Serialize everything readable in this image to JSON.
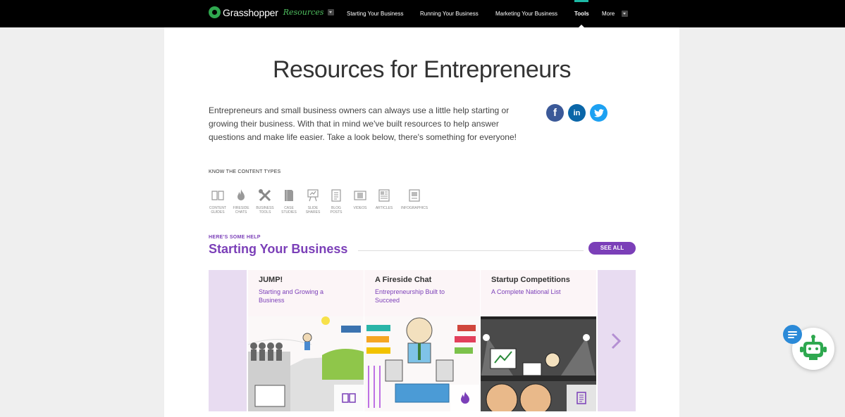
{
  "nav": {
    "brand": "Grasshopper",
    "brand_sub": "Resources",
    "items": [
      {
        "label": "Starting Your Business"
      },
      {
        "label": "Running Your Business"
      },
      {
        "label": "Marketing Your Business"
      },
      {
        "label": "Tools"
      },
      {
        "label": "More"
      }
    ],
    "active": "Tools",
    "accent_color": "#1db9a5"
  },
  "page": {
    "title": "Resources for Entrepreneurs",
    "intro": "Entrepreneurs and small business owners can always use a little help starting or growing their business. With that in mind we've built resources to help answer questions and make life easier. Take a look below, there's something for everyone!"
  },
  "social": [
    {
      "icon": "facebook-icon",
      "glyph": "f",
      "color": "#3b5998"
    },
    {
      "icon": "linkedin-icon",
      "glyph": "in",
      "color": "#0a66a8"
    },
    {
      "icon": "twitter-icon",
      "glyph": "t",
      "color": "#1da1f2"
    }
  ],
  "content_types": {
    "heading": "KNOW THE CONTENT TYPES",
    "items": [
      {
        "line1": "CONTENT",
        "line2": "GUIDES",
        "icon": "book-icon"
      },
      {
        "line1": "FIRESIDE",
        "line2": "CHATS",
        "icon": "flame-icon"
      },
      {
        "line1": "BUSINESS",
        "line2": "TOOLS",
        "icon": "tools-icon"
      },
      {
        "line1": "CASE",
        "line2": "STUDIES",
        "icon": "binder-icon"
      },
      {
        "line1": "SLIDE",
        "line2": "SHARES",
        "icon": "easel-icon"
      },
      {
        "line1": "BLOG",
        "line2": "POSTS",
        "icon": "document-icon"
      },
      {
        "line1": "VIDEOS",
        "line2": "",
        "icon": "film-icon"
      },
      {
        "line1": "ARTICLES",
        "line2": "",
        "icon": "article-icon"
      },
      {
        "line1": "INFOGRAPHICS",
        "line2": "",
        "icon": "infographic-icon"
      }
    ]
  },
  "section": {
    "kicker": "HERE'S SOME HELP",
    "title": "Starting Your Business",
    "see_all": "SEE ALL",
    "brand_color": "#7b3fb8"
  },
  "cards": [
    {
      "title": "JUMP!",
      "subtitle": "Starting and Growing a Business",
      "badge_icon": "book-icon"
    },
    {
      "title": "A Fireside Chat",
      "subtitle": "Entrepreneurship Built to Succeed",
      "badge_icon": "flame-icon"
    },
    {
      "title": "Startup Competitions",
      "subtitle": "A Complete National List",
      "badge_icon": "document-icon"
    }
  ]
}
